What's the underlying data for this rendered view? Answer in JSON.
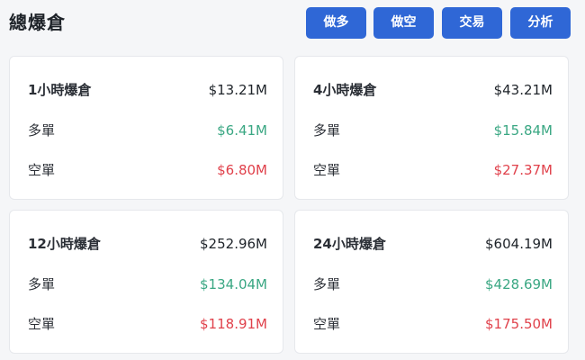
{
  "header": {
    "title": "總爆倉",
    "buttons": {
      "long": "做多",
      "short": "做空",
      "trade": "交易",
      "analysis": "分析"
    }
  },
  "cards": [
    {
      "period": "1小時爆倉",
      "total": "$13.21M",
      "long_label": "多單",
      "long_value": "$6.41M",
      "short_label": "空單",
      "short_value": "$6.80M"
    },
    {
      "period": "4小時爆倉",
      "total": "$43.21M",
      "long_label": "多單",
      "long_value": "$15.84M",
      "short_label": "空單",
      "short_value": "$27.37M"
    },
    {
      "period": "12小時爆倉",
      "total": "$252.96M",
      "long_label": "多單",
      "long_value": "$134.04M",
      "short_label": "空單",
      "short_value": "$118.91M"
    },
    {
      "period": "24小時爆倉",
      "total": "$604.19M",
      "long_label": "多單",
      "long_value": "$428.69M",
      "short_label": "空單",
      "short_value": "$175.50M"
    }
  ],
  "colors": {
    "accent": "#2f67d6",
    "long": "#3aa783",
    "short": "#e0414b"
  }
}
